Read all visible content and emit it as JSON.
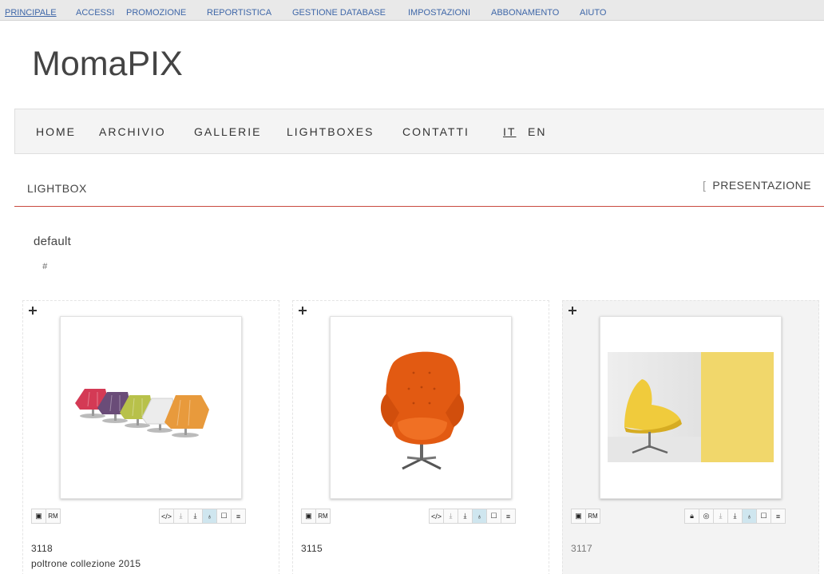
{
  "adminbar": {
    "items": [
      "PRINCIPALE",
      "ACCESSI",
      "PROMOZIONE",
      "REPORTISTICA",
      "GESTIONE DATABASE",
      "IMPOSTAZIONI",
      "ABBONAMENTO",
      "AIUTO"
    ]
  },
  "logo": "MomaPIX",
  "nav": {
    "items": [
      "HOME",
      "ARCHIVIO",
      "GALLERIE",
      "LIGHTBOXES",
      "CONTATTI"
    ],
    "lang_it": "IT",
    "lang_en": "EN"
  },
  "section": {
    "title": "LIGHTBOX",
    "bracket": "[",
    "presentation": "PRESENTAZIONE"
  },
  "lightbox": {
    "name": "default",
    "hash": "#"
  },
  "toolbar": {
    "rm_label": "RM"
  },
  "cards": [
    {
      "id": "3118",
      "description": "poltrone collezione 2015",
      "image": "row of colorful lounge chairs"
    },
    {
      "id": "3115",
      "description": "",
      "image": "orange egg chair"
    },
    {
      "id": "3117",
      "description": "",
      "image": "yellow chair beside yellow wall panel"
    }
  ],
  "colors": {
    "link": "#3f67a8",
    "accent_line": "#c94a3f",
    "active_button": "#cfe6ef"
  }
}
